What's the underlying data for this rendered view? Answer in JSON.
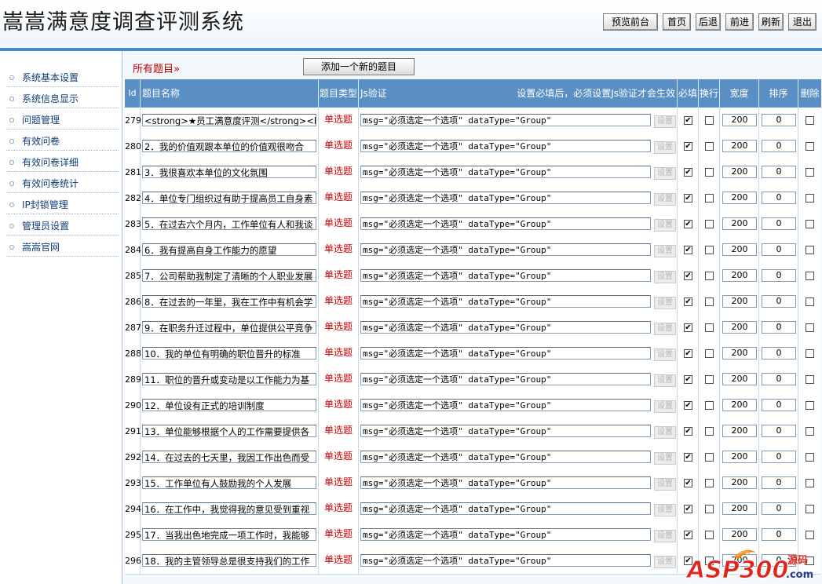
{
  "header": {
    "title": "嵩嵩满意度调查评测系统",
    "buttons": [
      "预览前台",
      "首页",
      "后退",
      "前进",
      "刷新",
      "退出"
    ]
  },
  "sidebar": {
    "items": [
      "系统基本设置",
      "系统信息显示",
      "问题管理",
      "有效问卷",
      "有效问卷详细",
      "有效问卷统计",
      "IP封锁管理",
      "管理员设置",
      "嵩嵩官网"
    ]
  },
  "main": {
    "section_title": "所有题目»",
    "add_button": "添加一个新的题目",
    "columns": {
      "id": "Id",
      "name": "题目名称",
      "type": "题目类型",
      "js": "Js验证",
      "js_note": "设置必填后，必须设置Js验证才会生效",
      "required": "必填",
      "wrap": "换行",
      "width": "宽度",
      "order": "排序",
      "delete": "删除"
    },
    "set_label": "设置",
    "rows": [
      {
        "id": "279",
        "name": "<strong>★员工满意度评测</strong><br",
        "type": "单选题",
        "js": "msg=\"必须选定一个选项\" dataType=\"Group\"",
        "required": true,
        "wrap": false,
        "width": "200",
        "order": "0",
        "delete": false
      },
      {
        "id": "280",
        "name": "2．我的价值观跟本单位的价值观很吻合",
        "type": "单选题",
        "js": "msg=\"必须选定一个选项\" dataType=\"Group\"",
        "required": true,
        "wrap": false,
        "width": "200",
        "order": "0",
        "delete": false
      },
      {
        "id": "281",
        "name": "3．我很喜欢本单位的文化氛围",
        "type": "单选题",
        "js": "msg=\"必须选定一个选项\" dataType=\"Group\"",
        "required": true,
        "wrap": false,
        "width": "200",
        "order": "0",
        "delete": false
      },
      {
        "id": "282",
        "name": "4．单位专门组织过有助于提高员工自身素",
        "type": "单选题",
        "js": "msg=\"必须选定一个选项\" dataType=\"Group\"",
        "required": true,
        "wrap": false,
        "width": "200",
        "order": "0",
        "delete": false
      },
      {
        "id": "283",
        "name": "5．在过去六个月内，工作单位有人和我谈",
        "type": "单选题",
        "js": "msg=\"必须选定一个选项\" dataType=\"Group\"",
        "required": true,
        "wrap": false,
        "width": "200",
        "order": "0",
        "delete": false
      },
      {
        "id": "284",
        "name": "6．我有提高自身工作能力的愿望",
        "type": "单选题",
        "js": "msg=\"必须选定一个选项\" dataType=\"Group\"",
        "required": true,
        "wrap": false,
        "width": "200",
        "order": "0",
        "delete": false
      },
      {
        "id": "285",
        "name": "7．公司帮助我制定了清晰的个人职业发展",
        "type": "单选题",
        "js": "msg=\"必须选定一个选项\" dataType=\"Group\"",
        "required": true,
        "wrap": false,
        "width": "200",
        "order": "0",
        "delete": false
      },
      {
        "id": "286",
        "name": "8．在过去的一年里，我在工作中有机会学",
        "type": "单选题",
        "js": "msg=\"必须选定一个选项\" dataType=\"Group\"",
        "required": true,
        "wrap": false,
        "width": "200",
        "order": "0",
        "delete": false
      },
      {
        "id": "287",
        "name": "9．在职务升迁过程中，单位提供公平竞争",
        "type": "单选题",
        "js": "msg=\"必须选定一个选项\" dataType=\"Group\"",
        "required": true,
        "wrap": false,
        "width": "200",
        "order": "0",
        "delete": false
      },
      {
        "id": "288",
        "name": "10．我的单位有明确的职位晋升的标准",
        "type": "单选题",
        "js": "msg=\"必须选定一个选项\" dataType=\"Group\"",
        "required": true,
        "wrap": false,
        "width": "200",
        "order": "0",
        "delete": false
      },
      {
        "id": "289",
        "name": "11．职位的晋升或变动是以工作能力为基",
        "type": "单选题",
        "js": "msg=\"必须选定一个选项\" dataType=\"Group\"",
        "required": true,
        "wrap": false,
        "width": "200",
        "order": "0",
        "delete": false
      },
      {
        "id": "290",
        "name": "12．单位设有正式的培训制度",
        "type": "单选题",
        "js": "msg=\"必须选定一个选项\" dataType=\"Group\"",
        "required": true,
        "wrap": false,
        "width": "200",
        "order": "0",
        "delete": false
      },
      {
        "id": "291",
        "name": "13．单位能够根据个人的工作需要提供各",
        "type": "单选题",
        "js": "msg=\"必须选定一个选项\" dataType=\"Group\"",
        "required": true,
        "wrap": false,
        "width": "200",
        "order": "0",
        "delete": false
      },
      {
        "id": "292",
        "name": "14．在过去的七天里，我因工作出色而受",
        "type": "单选题",
        "js": "msg=\"必须选定一个选项\" dataType=\"Group\"",
        "required": true,
        "wrap": false,
        "width": "200",
        "order": "0",
        "delete": false
      },
      {
        "id": "293",
        "name": "15．工作单位有人鼓励我的个人发展",
        "type": "单选题",
        "js": "msg=\"必须选定一个选项\" dataType=\"Group\"",
        "required": true,
        "wrap": false,
        "width": "200",
        "order": "0",
        "delete": false
      },
      {
        "id": "294",
        "name": "16．在工作中，我觉得我的意见受到重视",
        "type": "单选题",
        "js": "msg=\"必须选定一个选项\" dataType=\"Group\"",
        "required": true,
        "wrap": false,
        "width": "200",
        "order": "0",
        "delete": false
      },
      {
        "id": "295",
        "name": "17．当我出色地完成一项工作时，我能够",
        "type": "单选题",
        "js": "msg=\"必须选定一个选项\" dataType=\"Group\"",
        "required": true,
        "wrap": false,
        "width": "200",
        "order": "0",
        "delete": false
      },
      {
        "id": "296",
        "name": "18．我的主管领导总是很支持我们的工作",
        "type": "单选题",
        "js": "msg=\"必须选定一个选项\" dataType=\"Group\"",
        "required": true,
        "wrap": false,
        "width": "200",
        "order": "0",
        "delete": false
      }
    ]
  },
  "watermark": {
    "text": "ASP300",
    "sub": "源码",
    "domain": ".com"
  },
  "colors": {
    "header_bar": "#5a8fc6",
    "accent_line": "#3d8ccf",
    "type_red": "#d40000",
    "title_red": "#c00000"
  }
}
